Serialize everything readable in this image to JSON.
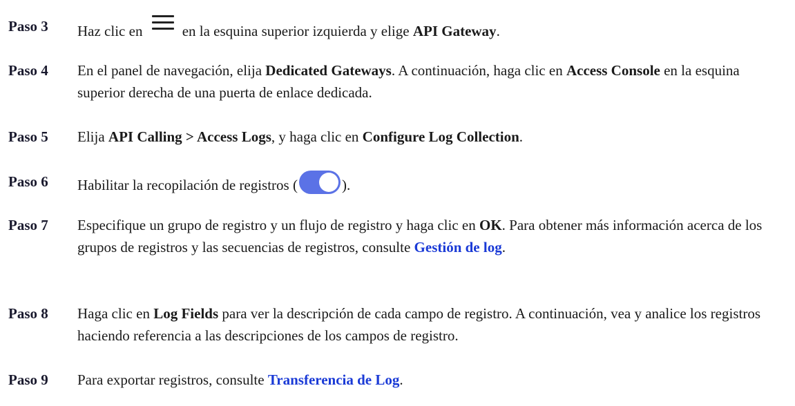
{
  "steps": [
    {
      "label": "Paso 3",
      "t1": "Haz clic en",
      "t2": "en la esquina superior izquierda y elige",
      "b1": "API Gateway",
      "t3": "."
    },
    {
      "label": "Paso 4",
      "t1": "En el panel de navegación, elija",
      "b1": "Dedicated Gateways",
      "t2": ". A continuación, haga clic en",
      "b2": "Access Console",
      "t3": "en la esquina superior derecha de una puerta de enlace dedicada."
    },
    {
      "label": "Paso 5",
      "t1": "Elija",
      "b1": "API Calling > Access Logs",
      "t2": ", y haga clic en",
      "b2": "Configure Log Collection",
      "t3": "."
    },
    {
      "label": "Paso 6",
      "t1": "Habilitar la recopilación de registros (",
      "t2": ")."
    },
    {
      "label": "Paso 7",
      "t1": "Especifique un grupo de registro y un flujo de registro y haga clic en",
      "b1": "OK",
      "t2": ". Para obtener más información acerca de los grupos de registros y las secuencias de registros, consulte",
      "link": "Gestión de log",
      "t3": "."
    },
    {
      "label": "Paso 8",
      "t1": "Haga clic en",
      "b1": "Log Fields",
      "t2": "para ver la descripción de cada campo de registro. A continuación, vea y analice los registros haciendo referencia a las descripciones de los campos de registro."
    },
    {
      "label": "Paso 9",
      "t1": "Para exportar registros, consulte",
      "link": "Transferencia de Log",
      "t2": "."
    }
  ],
  "icons": {
    "menu": "hamburger-menu-icon",
    "toggle": "toggle-switch-on-icon"
  },
  "colors": {
    "link": "#1a3ad6",
    "toggle": "#5b72e6"
  }
}
